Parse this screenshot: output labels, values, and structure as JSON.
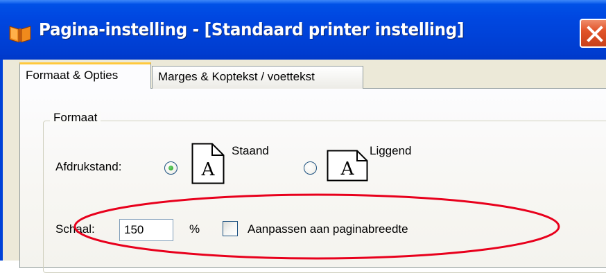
{
  "window": {
    "title": "Pagina-instelling - [Standaard printer instelling]",
    "icon": "book-icon",
    "close_icon": "close-x-icon",
    "titlebar_color": "#0042d8",
    "close_color": "#e1542a"
  },
  "tabs": [
    {
      "label": "Formaat & Opties",
      "active": true
    },
    {
      "label": "Marges & Koptekst / voettekst",
      "active": false
    }
  ],
  "format_group": {
    "legend": "Formaat",
    "orientation": {
      "label": "Afdrukstand:",
      "options": [
        {
          "label": "Staand",
          "selected": true,
          "icon": "portrait-page-icon",
          "glyph": "A"
        },
        {
          "label": "Liggend",
          "selected": false,
          "icon": "landscape-page-icon",
          "glyph": "A"
        }
      ]
    },
    "scale": {
      "label": "Schaal:",
      "value": "150",
      "unit": "%",
      "fit_checkbox_label": "Aanpassen aan paginabreedte",
      "fit_checked": false
    }
  },
  "annotation": {
    "shape": "ellipse",
    "color": "#e8001c"
  }
}
